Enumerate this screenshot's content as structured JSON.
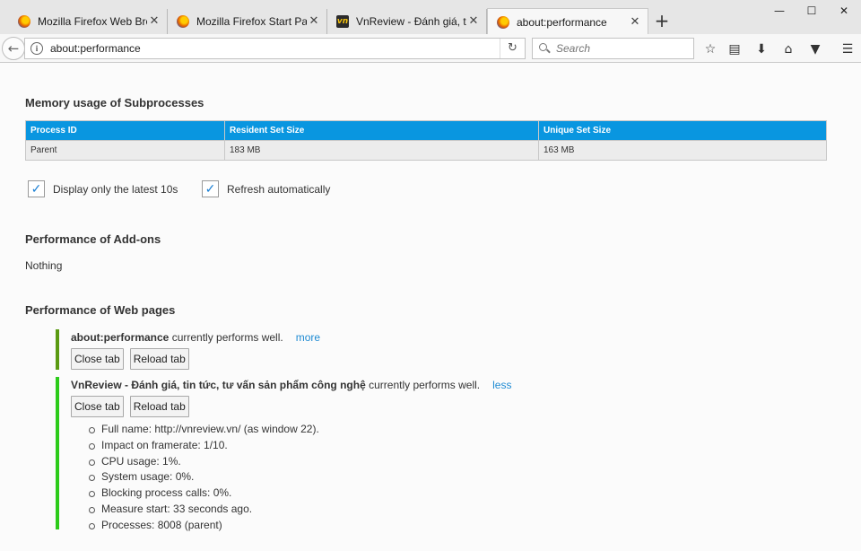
{
  "tabs": [
    {
      "title": "Mozilla Firefox Web Browser — Free Download",
      "icon": "firefox-icon",
      "active": false
    },
    {
      "title": "Mozilla Firefox Start Page",
      "icon": "firefox-icon",
      "active": false
    },
    {
      "title": "VnReview - Đánh giá, tin tức, tư vấn",
      "icon": "vnreview-icon",
      "active": false
    },
    {
      "title": "about:performance",
      "icon": "firefox-icon",
      "active": true
    }
  ],
  "nav": {
    "url": "about:performance",
    "search_placeholder": "Search"
  },
  "memory": {
    "heading": "Memory usage of Subprocesses",
    "columns": [
      "Process ID",
      "Resident Set Size",
      "Unique Set Size"
    ],
    "rows": [
      [
        "Parent",
        "183 MB",
        "163 MB"
      ]
    ]
  },
  "options": {
    "latest": "Display only the latest 10s",
    "refresh": "Refresh automatically"
  },
  "addons": {
    "heading": "Performance of Add-ons",
    "empty": "Nothing"
  },
  "webpages": {
    "heading": "Performance of Web pages",
    "entries": [
      {
        "name": "about:performance",
        "status": " currently performs well.",
        "toggle": "more",
        "close": "Close tab",
        "reload": "Reload tab"
      },
      {
        "name": "VnReview - Đánh giá, tin tức, tư vấn sản phẩm công nghệ",
        "status": " currently performs well.",
        "toggle": "less",
        "close": "Close tab",
        "reload": "Reload tab",
        "details": [
          "Full name: http://vnreview.vn/ (as window 22).",
          "Impact on framerate: 1/10.",
          "CPU usage: 1%.",
          "System usage: 0%.",
          "Blocking process calls: 0%.",
          "Measure start: 33 seconds ago.",
          "Processes: 8008 (parent)"
        ]
      }
    ]
  },
  "colors": {
    "table_header": "#0996e0",
    "link": "#1f8bd3",
    "entry_border_1": "#5a9a12",
    "entry_border_2": "#2ccb1a"
  }
}
